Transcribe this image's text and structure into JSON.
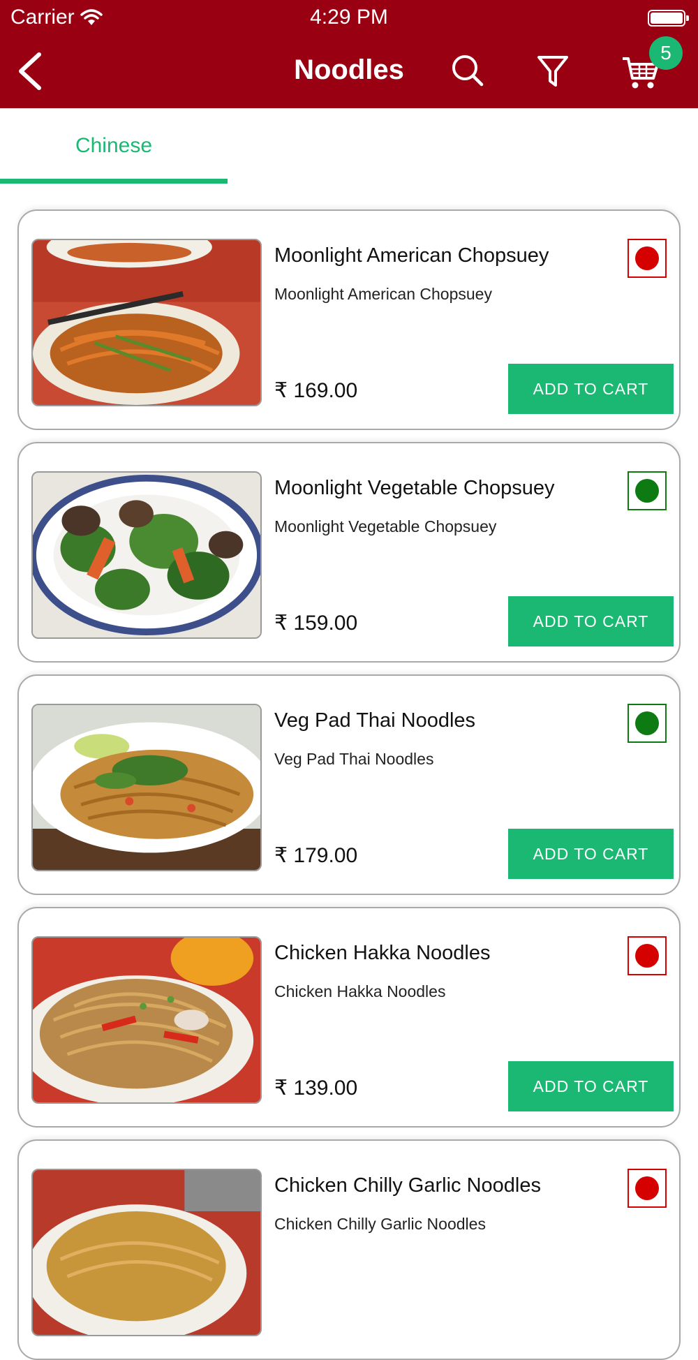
{
  "status_bar": {
    "carrier": "Carrier",
    "time": "4:29 PM"
  },
  "nav": {
    "title": "Noodles",
    "cart_count": "5",
    "icons": [
      "back-chevron-icon",
      "search-icon",
      "filter-icon",
      "cart-icon"
    ]
  },
  "tabs": [
    {
      "label": "Chinese"
    }
  ],
  "colors": {
    "header_bg": "#990012",
    "accent_green": "#1ab873",
    "nonveg_red": "#d50000",
    "veg_green": "#0d7a12"
  },
  "items": [
    {
      "name": "Moonlight American Chopsuey",
      "description": "Moonlight American Chopsuey",
      "price": "₹ 169.00",
      "button": "ADD TO CART",
      "diet": "non-veg"
    },
    {
      "name": "Moonlight Vegetable Chopsuey",
      "description": "Moonlight Vegetable Chopsuey",
      "price": "₹ 159.00",
      "button": "ADD TO CART",
      "diet": "veg"
    },
    {
      "name": "Veg Pad Thai Noodles",
      "description": "Veg Pad Thai Noodles",
      "price": "₹ 179.00",
      "button": "ADD TO CART",
      "diet": "veg"
    },
    {
      "name": "Chicken Hakka Noodles",
      "description": "Chicken Hakka Noodles",
      "price": "₹ 139.00",
      "button": "ADD TO CART",
      "diet": "non-veg"
    },
    {
      "name": "Chicken Chilly Garlic Noodles",
      "description": "Chicken Chilly Garlic Noodles",
      "price": "",
      "button": "",
      "diet": "non-veg"
    }
  ]
}
